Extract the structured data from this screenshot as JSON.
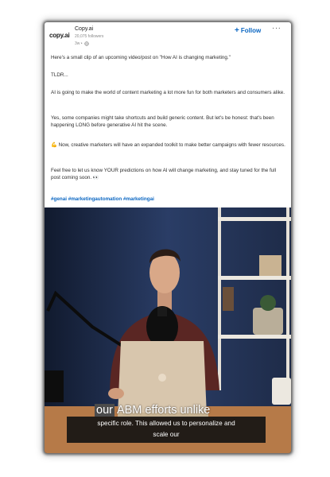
{
  "post": {
    "logo_text": "copy.ai",
    "account_name": "Copy.ai",
    "followers": "20,075 followers",
    "time": "3w •",
    "follow_label": "Follow",
    "more_label": "···",
    "paragraphs": [
      "Here's a small clip of an upcoming video/post on \"How AI is changing marketing.\"",
      "TLDR...",
      "AI is going to make the world of content marketing a lot more fun for both marketers and consumers alike.",
      "Yes, some companies might take shortcuts and build generic content. But let's be honest: that's been happening LONG before generative AI hit the scene.",
      "Now, creative marketers will have an expanded toolkit to make better campaigns with fewer resources.",
      "Feel free to let us know YOUR predictions on how AI will change marketing, and stay tuned for the full post coming soon."
    ],
    "emoji_strong": "💪",
    "emoji_eyes": "👀",
    "hashtags": "#genai #marketingautomation #marketingai"
  },
  "video": {
    "caption_highlight": "our",
    "caption_rest": "ABM efforts unlike",
    "subtitle_line1": "specific role. This allowed us to personalize and",
    "subtitle_line2": "scale our",
    "laptop_logo": ""
  }
}
